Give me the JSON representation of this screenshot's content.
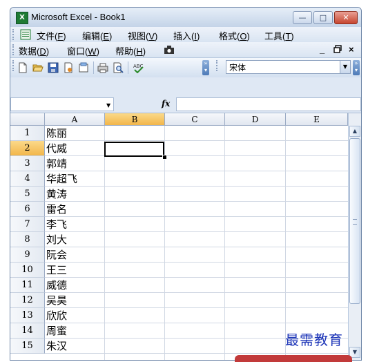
{
  "window": {
    "title": "Microsoft Excel - Book1",
    "app_icon": "X",
    "buttons": {
      "minimize": "—",
      "maximize": "□",
      "close": "✕"
    }
  },
  "menu": {
    "row1": [
      {
        "label": "文件(",
        "key": "F",
        "end": ")"
      },
      {
        "label": "编辑(",
        "key": "E",
        "end": ")"
      },
      {
        "label": "视图(",
        "key": "V",
        "end": ")"
      },
      {
        "label": "插入(",
        "key": "I",
        "end": ")"
      },
      {
        "label": "格式(",
        "key": "O",
        "end": ")"
      },
      {
        "label": "工具(",
        "key": "T",
        "end": ")"
      }
    ],
    "row2": [
      {
        "label": "数据(",
        "key": "D",
        "end": ")"
      },
      {
        "label": "窗口(",
        "key": "W",
        "end": ")"
      },
      {
        "label": "帮助(",
        "key": "H",
        "end": ")"
      }
    ],
    "doc_controls": {
      "minimize": "_",
      "restore": "ꟷ",
      "close": "×"
    }
  },
  "toolbar": {
    "icons": [
      "new-icon",
      "open-icon",
      "save-icon",
      "permission-icon",
      "print-icon",
      "print-preview-icon",
      "spelling-icon"
    ],
    "font_name": "宋体"
  },
  "formula_bar": {
    "name_box": "",
    "fx": "fx",
    "formula": ""
  },
  "sheet": {
    "columns": [
      "A",
      "B",
      "C",
      "D",
      "E"
    ],
    "active_column": "B",
    "active_row": "2",
    "rows": [
      {
        "num": "1",
        "a": "陈丽"
      },
      {
        "num": "2",
        "a": "代威"
      },
      {
        "num": "3",
        "a": "郭靖"
      },
      {
        "num": "4",
        "a": "华超飞"
      },
      {
        "num": "5",
        "a": "黄涛"
      },
      {
        "num": "6",
        "a": "雷名"
      },
      {
        "num": "7",
        "a": "李飞"
      },
      {
        "num": "8",
        "a": "刘大"
      },
      {
        "num": "9",
        "a": "阮会"
      },
      {
        "num": "10",
        "a": "王三"
      },
      {
        "num": "11",
        "a": "威德"
      },
      {
        "num": "12",
        "a": "吴昊"
      },
      {
        "num": "13",
        "a": "欣欣"
      },
      {
        "num": "14",
        "a": "周蜜"
      },
      {
        "num": "15",
        "a": "朱汉"
      }
    ]
  },
  "watermark": "最需教育",
  "colors": {
    "accent": "#f2b64a",
    "window_frame": "#cfdcec",
    "close_button": "#c6452f",
    "watermark": "#1d35b8"
  }
}
